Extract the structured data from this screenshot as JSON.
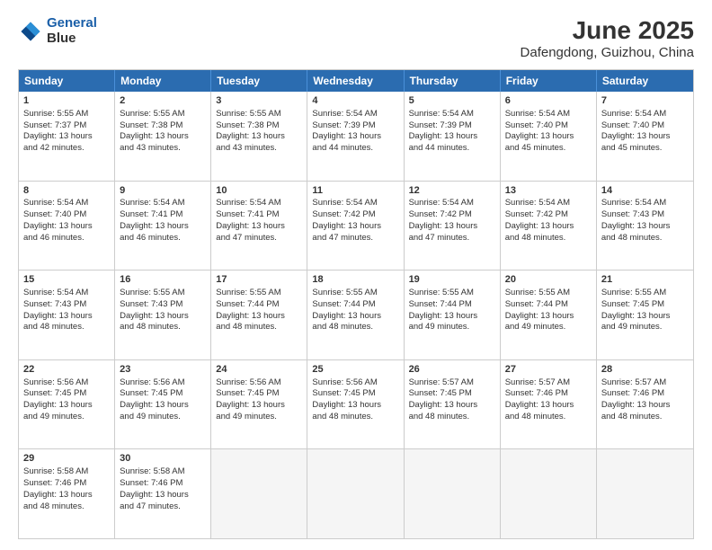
{
  "header": {
    "logo_line1": "General",
    "logo_line2": "Blue",
    "month": "June 2025",
    "location": "Dafengdong, Guizhou, China"
  },
  "weekdays": [
    "Sunday",
    "Monday",
    "Tuesday",
    "Wednesday",
    "Thursday",
    "Friday",
    "Saturday"
  ],
  "rows": [
    [
      {
        "day": "1",
        "lines": [
          "Sunrise: 5:55 AM",
          "Sunset: 7:37 PM",
          "Daylight: 13 hours",
          "and 42 minutes."
        ]
      },
      {
        "day": "2",
        "lines": [
          "Sunrise: 5:55 AM",
          "Sunset: 7:38 PM",
          "Daylight: 13 hours",
          "and 43 minutes."
        ]
      },
      {
        "day": "3",
        "lines": [
          "Sunrise: 5:55 AM",
          "Sunset: 7:38 PM",
          "Daylight: 13 hours",
          "and 43 minutes."
        ]
      },
      {
        "day": "4",
        "lines": [
          "Sunrise: 5:54 AM",
          "Sunset: 7:39 PM",
          "Daylight: 13 hours",
          "and 44 minutes."
        ]
      },
      {
        "day": "5",
        "lines": [
          "Sunrise: 5:54 AM",
          "Sunset: 7:39 PM",
          "Daylight: 13 hours",
          "and 44 minutes."
        ]
      },
      {
        "day": "6",
        "lines": [
          "Sunrise: 5:54 AM",
          "Sunset: 7:40 PM",
          "Daylight: 13 hours",
          "and 45 minutes."
        ]
      },
      {
        "day": "7",
        "lines": [
          "Sunrise: 5:54 AM",
          "Sunset: 7:40 PM",
          "Daylight: 13 hours",
          "and 45 minutes."
        ]
      }
    ],
    [
      {
        "day": "8",
        "lines": [
          "Sunrise: 5:54 AM",
          "Sunset: 7:40 PM",
          "Daylight: 13 hours",
          "and 46 minutes."
        ]
      },
      {
        "day": "9",
        "lines": [
          "Sunrise: 5:54 AM",
          "Sunset: 7:41 PM",
          "Daylight: 13 hours",
          "and 46 minutes."
        ]
      },
      {
        "day": "10",
        "lines": [
          "Sunrise: 5:54 AM",
          "Sunset: 7:41 PM",
          "Daylight: 13 hours",
          "and 47 minutes."
        ]
      },
      {
        "day": "11",
        "lines": [
          "Sunrise: 5:54 AM",
          "Sunset: 7:42 PM",
          "Daylight: 13 hours",
          "and 47 minutes."
        ]
      },
      {
        "day": "12",
        "lines": [
          "Sunrise: 5:54 AM",
          "Sunset: 7:42 PM",
          "Daylight: 13 hours",
          "and 47 minutes."
        ]
      },
      {
        "day": "13",
        "lines": [
          "Sunrise: 5:54 AM",
          "Sunset: 7:42 PM",
          "Daylight: 13 hours",
          "and 48 minutes."
        ]
      },
      {
        "day": "14",
        "lines": [
          "Sunrise: 5:54 AM",
          "Sunset: 7:43 PM",
          "Daylight: 13 hours",
          "and 48 minutes."
        ]
      }
    ],
    [
      {
        "day": "15",
        "lines": [
          "Sunrise: 5:54 AM",
          "Sunset: 7:43 PM",
          "Daylight: 13 hours",
          "and 48 minutes."
        ]
      },
      {
        "day": "16",
        "lines": [
          "Sunrise: 5:55 AM",
          "Sunset: 7:43 PM",
          "Daylight: 13 hours",
          "and 48 minutes."
        ]
      },
      {
        "day": "17",
        "lines": [
          "Sunrise: 5:55 AM",
          "Sunset: 7:44 PM",
          "Daylight: 13 hours",
          "and 48 minutes."
        ]
      },
      {
        "day": "18",
        "lines": [
          "Sunrise: 5:55 AM",
          "Sunset: 7:44 PM",
          "Daylight: 13 hours",
          "and 48 minutes."
        ]
      },
      {
        "day": "19",
        "lines": [
          "Sunrise: 5:55 AM",
          "Sunset: 7:44 PM",
          "Daylight: 13 hours",
          "and 49 minutes."
        ]
      },
      {
        "day": "20",
        "lines": [
          "Sunrise: 5:55 AM",
          "Sunset: 7:44 PM",
          "Daylight: 13 hours",
          "and 49 minutes."
        ]
      },
      {
        "day": "21",
        "lines": [
          "Sunrise: 5:55 AM",
          "Sunset: 7:45 PM",
          "Daylight: 13 hours",
          "and 49 minutes."
        ]
      }
    ],
    [
      {
        "day": "22",
        "lines": [
          "Sunrise: 5:56 AM",
          "Sunset: 7:45 PM",
          "Daylight: 13 hours",
          "and 49 minutes."
        ]
      },
      {
        "day": "23",
        "lines": [
          "Sunrise: 5:56 AM",
          "Sunset: 7:45 PM",
          "Daylight: 13 hours",
          "and 49 minutes."
        ]
      },
      {
        "day": "24",
        "lines": [
          "Sunrise: 5:56 AM",
          "Sunset: 7:45 PM",
          "Daylight: 13 hours",
          "and 49 minutes."
        ]
      },
      {
        "day": "25",
        "lines": [
          "Sunrise: 5:56 AM",
          "Sunset: 7:45 PM",
          "Daylight: 13 hours",
          "and 48 minutes."
        ]
      },
      {
        "day": "26",
        "lines": [
          "Sunrise: 5:57 AM",
          "Sunset: 7:45 PM",
          "Daylight: 13 hours",
          "and 48 minutes."
        ]
      },
      {
        "day": "27",
        "lines": [
          "Sunrise: 5:57 AM",
          "Sunset: 7:46 PM",
          "Daylight: 13 hours",
          "and 48 minutes."
        ]
      },
      {
        "day": "28",
        "lines": [
          "Sunrise: 5:57 AM",
          "Sunset: 7:46 PM",
          "Daylight: 13 hours",
          "and 48 minutes."
        ]
      }
    ],
    [
      {
        "day": "29",
        "lines": [
          "Sunrise: 5:58 AM",
          "Sunset: 7:46 PM",
          "Daylight: 13 hours",
          "and 48 minutes."
        ]
      },
      {
        "day": "30",
        "lines": [
          "Sunrise: 5:58 AM",
          "Sunset: 7:46 PM",
          "Daylight: 13 hours",
          "and 47 minutes."
        ]
      },
      {
        "day": "",
        "lines": []
      },
      {
        "day": "",
        "lines": []
      },
      {
        "day": "",
        "lines": []
      },
      {
        "day": "",
        "lines": []
      },
      {
        "day": "",
        "lines": []
      }
    ]
  ]
}
